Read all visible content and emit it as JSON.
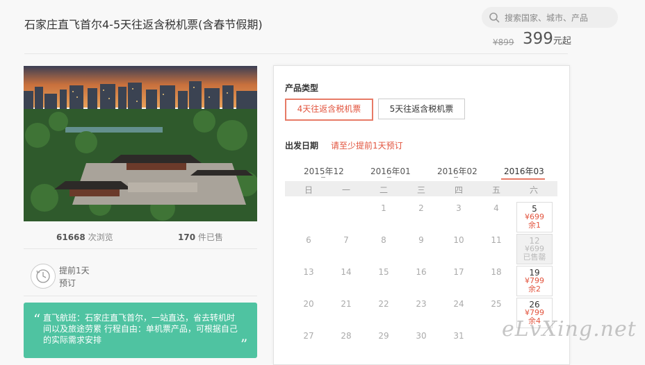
{
  "header": {
    "title": "石家庄直飞首尔4-5天往返含税机票(含春节假期)",
    "search_placeholder": "搜索国家、城市、产品",
    "price_original": "¥899",
    "price_current": "399",
    "price_unit": "元起"
  },
  "stats": {
    "views_count": "61668",
    "views_label": "次浏览",
    "sold_count": "170",
    "sold_label": "件已售"
  },
  "booking_notice": {
    "line1": "提前1天",
    "line2": "预订"
  },
  "highlights": "直飞航班：石家庄直飞首尔，一站直达，省去转机时间以及旅途劳累 行程自由：单机票产品，可根据自己的实际需求安排",
  "panel": {
    "product_type_label": "产品类型",
    "options": [
      "4天往返含税机票",
      "5天往返含税机票"
    ],
    "departure_label": "出发日期",
    "departure_hint": "请至少提前1天预订",
    "months": [
      "2015年12",
      "2016年01",
      "2016年02",
      "2016年03"
    ],
    "weekdays": [
      "日",
      "一",
      "二",
      "三",
      "四",
      "五",
      "六"
    ],
    "plain_days": [
      "1",
      "2",
      "3",
      "4",
      "6",
      "7",
      "8",
      "9",
      "10",
      "11",
      "13",
      "14",
      "15",
      "16",
      "17",
      "18",
      "20",
      "21",
      "22",
      "23",
      "24",
      "25",
      "27",
      "28",
      "29",
      "30",
      "31"
    ],
    "priced_days": [
      {
        "date": "5",
        "price": "¥699",
        "stock": "余1"
      },
      {
        "date": "12",
        "price": "¥699",
        "stock": "已售罄"
      },
      {
        "date": "19",
        "price": "¥799",
        "stock": "余2"
      },
      {
        "date": "26",
        "price": "¥799",
        "stock": "余4"
      }
    ]
  },
  "watermark": "eLvXing.net",
  "colors": {
    "accent": "#e2543e",
    "green": "#4fc3a1"
  }
}
